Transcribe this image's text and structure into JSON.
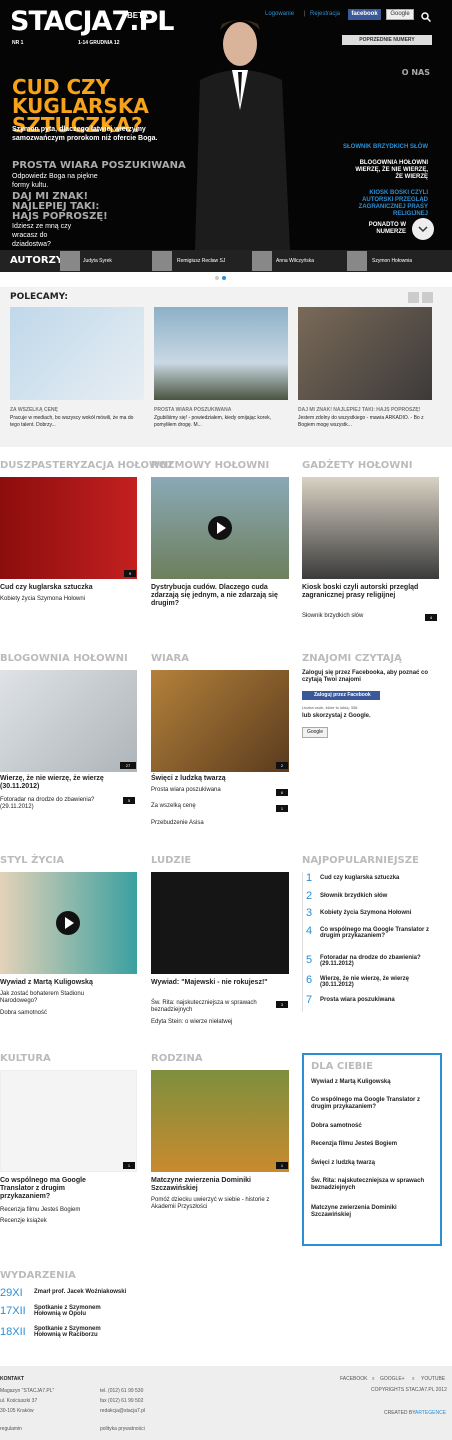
{
  "header": {
    "logo": "STACJA7.PL",
    "beta": "BETA",
    "issue": "NR 1",
    "date": "1-14 GRUDNIA 12",
    "login": "Logowanie",
    "register": "Rejestracja",
    "facebook": "facebook",
    "google": "Google",
    "previous_issues": "POPRZEDNIE NUMERY"
  },
  "hero": {
    "title_line1": "CUD CZY",
    "title_line2": "KUGLARSKA",
    "title_line3": "SZTUCZKA?",
    "lead": "Szymon pyta, dlaczego łatwiej wierzymy samozwańczym prorokom niż ofercie Boga.",
    "sub1": "PROSTA WIARA POSZUKIWANA",
    "sub1_text": "Odpowiedz Boga na piękne formy kultu.",
    "sub2": "DAJ MI ZNAK! NAJLEPIEJ TAKI: HAJS POPROSZĘ!",
    "sub2_text": "Idziesz ze mną czy wracasz do dziadostwa?",
    "o_nas": "O NAS",
    "right1": "SŁOWNIK BRZYDKICH SŁÓW",
    "right2": "BLOGOWNIA HOŁOWNI WIERZĘ, ŻE NIE WIERZĘ, ŻE WIERZĘ",
    "right3": "KIOSK BOSKI CZYLI AUTORSKI PRZEGLĄD ZAGRANICZNEJ PRASY RELIGIJNEJ",
    "more": "PONADTO W NUMERZE"
  },
  "authors": {
    "label": "AUTORZY",
    "names": [
      "Judyta Syrek",
      "Remigiusz Recław SJ",
      "Anna Wilczyńska",
      "Szymon Hołownia"
    ]
  },
  "polecamy": {
    "title": "POLECAMY:",
    "items": [
      {
        "kicker": "ZA WSZELKĄ CENĘ",
        "text": "Pracuje w mediach, bo wszyscy wokół mówili, że ma do tego talent. Dobrzy..."
      },
      {
        "kicker": "PROSTA WIARA POSZUKIWANA",
        "text": "Zgubiliśmy się! - powiedziałem, kiedy omijając korek, pomyliłem drogę. M..."
      },
      {
        "kicker": "DAJ MI ZNAK! NAJLEPIEJ TAKI: HAJS POPROSZĘ!",
        "text": "Jestem zdolny do wszystkiego - mawia ARKADIO. - Bo z Bogiem mogę wszystk..."
      }
    ]
  },
  "row1": [
    {
      "section": "DUSZPASTERYZACJA HOŁOWNI",
      "count": "9",
      "title": "Cud czy kuglarska sztuczka",
      "sub": "Kobiety życia Szymona Hołowni"
    },
    {
      "section": "ROZMOWY HOŁOWNI",
      "title": "Dystrybucja cudów. Dlaczego cuda zdarzają się jednym, a nie zdarzają się drugim?"
    },
    {
      "section": "GADŻETY HOŁOWNI",
      "title": "Kiosk boski czyli autorski przegląd zagranicznej prasy religijnej",
      "sub": "Słownik brzydkich słów",
      "count": "4"
    }
  ],
  "row2": {
    "blog": {
      "section": "BLOGOWNIA HOŁOWNI",
      "count": "27",
      "title": "Wierzę, że nie wierzę, że wierzę (30.11.2012)",
      "sub": "Fotoradar na drodze do zbawienia? (29.11.2012)",
      "subcount": "5"
    },
    "wiara": {
      "section": "WIARA",
      "count": "2",
      "title": "Święci z ludzką twarzą",
      "items": [
        "Prosta wiara poszukiwana",
        "Za wszelką cenę",
        "Przebudzenie Asisa"
      ],
      "counts": [
        "6",
        "1"
      ]
    },
    "znajomi": {
      "section": "ZNAJOMI CZYTAJĄ",
      "text": "Zaloguj się przez Facebooka, aby poznać co czytają Twoi znajomi",
      "fb_button": "Zaloguj przez Facebook",
      "likes": "Liczba osób, które to lubią: 336.",
      "google_text": "lub skorzystaj z Google.",
      "google": "Google"
    }
  },
  "row3": {
    "styl": {
      "section": "STYL ŻYCIA",
      "title": "Wywiad z Martą Kuligowską",
      "items": [
        "Jak zostać bohaterem Stadionu Narodowego?",
        "Dobra samotność"
      ]
    },
    "ludzie": {
      "section": "LUDZIE",
      "title": "Wywiad: \"Majewski - nie rokujesz!\"",
      "items": [
        "Św. Rita: najskuteczniejsza w sprawach beznadziejnych",
        "Edyta Stein: o wierze niełatwej"
      ],
      "count": "3"
    },
    "popular": {
      "section": "NAJPOPULARNIEJSZE",
      "items": [
        "Cud czy kuglarska sztuczka",
        "Słownik brzydkich słów",
        "Kobiety życia Szymona Hołowni",
        "Co wspólnego ma Google Translator z drugim przykazaniem?",
        "Fotoradar na drodze do zbawienia? (29.11.2012)",
        "Wierzę, że nie wierzę, że wierzę (30.11.2012)",
        "Prosta wiara poszukiwana"
      ]
    }
  },
  "row4": {
    "kultura": {
      "section": "KULTURA",
      "count": "1",
      "title": "Co wspólnego ma Google Translator z drugim przykazaniem?",
      "items": [
        "Recenzja filmu Jesteś Bogiem",
        "Recenzje książek"
      ]
    },
    "rodzina": {
      "section": "RODZINA",
      "count": "1",
      "title": "Matczyne zwierzenia Dominiki Szczawińskiej",
      "sub": "Pomóż dziecku uwierzyć w siebie - historie z Akademii Przyszłości"
    },
    "dla": {
      "section": "DLA CIEBIE",
      "items": [
        "Wywiad z Martą Kuligowską",
        "Co wspólnego ma Google Translator z drugim przykazaniem?",
        "Dobra samotność",
        "Recenzja filmu Jesteś Bogiem",
        "Święci z ludzką twarzą",
        "Św. Rita: najskuteczniejsza w sprawach beznadziejnych",
        "Matczyne zwierzenia Dominiki Szczawińskiej"
      ]
    }
  },
  "events": {
    "section": "WYDARZENIA",
    "items": [
      {
        "date": "29XI",
        "text": "Zmarł prof. Jacek Woźniakowski"
      },
      {
        "date": "17XII",
        "text": "Spotkanie z Szymonem Hołownią w Opolu"
      },
      {
        "date": "18XII",
        "text": "Spotkanie z Szymonem Hołownią w Raciborzu"
      }
    ]
  },
  "footer": {
    "kontakt": "KONTAKT",
    "addr1": "Magazyn \"STACJA7.PL\"",
    "addr2": "ul. Kościuszki 37",
    "addr3": "30-105 Kraków",
    "tel": "tel. (012) 61 99 530",
    "fax": "fax (012) 61 99 502",
    "mail": "redakcja@stacja7.pl",
    "regulamin": "regulamin",
    "polityka": "polityka prywatności",
    "fb": "FACEBOOK",
    "gplus": "GOOGLE+",
    "yt": "YOUTUBE",
    "copy": "COPYRIGHTS STACJA7.PL 2012",
    "created": "CREATED BY",
    "agency": "ARTEGENCE"
  }
}
